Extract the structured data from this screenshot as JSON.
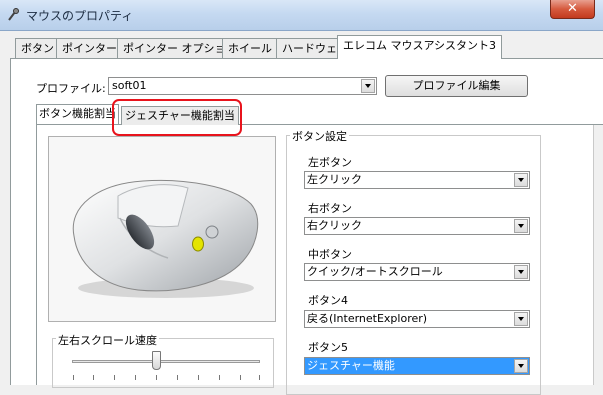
{
  "window": {
    "title": "マウスのプロパティ",
    "close_glyph": "✕"
  },
  "tabs": [
    {
      "label": "ボタン"
    },
    {
      "label": "ポインター"
    },
    {
      "label": "ポインター オプション"
    },
    {
      "label": "ホイール"
    },
    {
      "label": "ハードウェア"
    },
    {
      "label": "エレコム マウスアシスタント3"
    }
  ],
  "active_tab_index": 5,
  "profile": {
    "label": "プロファイル:",
    "value": "soft01",
    "edit_button": "プロファイル編集"
  },
  "inner_tabs": [
    {
      "label": "ボタン機能割当"
    },
    {
      "label": "ジェスチャー機能割当"
    }
  ],
  "highlight_color": "#e8131c",
  "scroll": {
    "label": "左右スクロール速度"
  },
  "button_settings": {
    "label": "ボタン設定",
    "fields": [
      {
        "label": "左ボタン",
        "value": "左クリック"
      },
      {
        "label": "右ボタン",
        "value": "右クリック"
      },
      {
        "label": "中ボタン",
        "value": "クイック/オートスクロール"
      },
      {
        "label": "ボタン4",
        "value": "戻る(InternetExplorer)"
      },
      {
        "label": "ボタン5",
        "value": "ジェスチャー機能"
      }
    ]
  },
  "icons": {
    "app": "mouse-app-icon",
    "mouse_image": "mouse-illustration"
  }
}
